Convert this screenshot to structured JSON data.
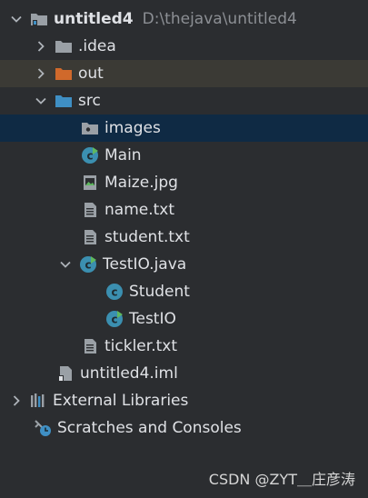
{
  "project": {
    "name": "untitled4",
    "path": "D:\\thejava\\untitled4"
  },
  "tree": {
    "idea": ".idea",
    "out": "out",
    "src": "src",
    "images": "images",
    "main": "Main",
    "maize": "Maize.jpg",
    "name_txt": "name.txt",
    "student_txt": "student.txt",
    "testio_java": "TestIO.java",
    "student_class": "Student",
    "testio_class": "TestIO",
    "tickler": "tickler.txt",
    "iml": "untitled4.iml",
    "external_libraries": "External Libraries",
    "scratches": "Scratches and Consoles"
  },
  "watermark": "CSDN @ZYT＿庄彦涛",
  "colors": {
    "background": "#2b2d30",
    "selected_row": "#0f2a44",
    "out_row": "#3b3a35",
    "folder_gray": "#9aa0a6",
    "folder_orange": "#d0692b",
    "folder_blue": "#3f8fc4",
    "class_circle": "#3b8fb0",
    "run_arrow": "#5fb85f"
  }
}
